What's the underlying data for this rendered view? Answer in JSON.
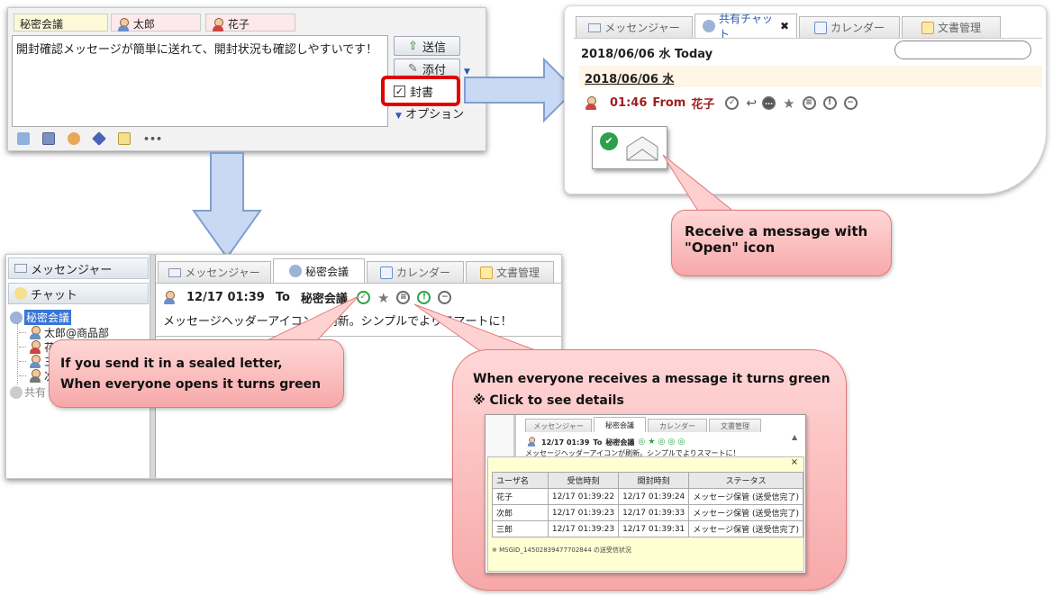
{
  "composer": {
    "recipients": [
      "秘密会議",
      "太郎",
      "花子"
    ],
    "message": "開封確認メッセージが簡単に送れて、開封状況も確認しやすいです！",
    "send_label": "送信",
    "attach_label": "添付",
    "seal_label": "封書",
    "sealed_checked": true,
    "options_label": "オプション",
    "more_label": "•••"
  },
  "receiver": {
    "tabs": [
      "メッセンジャー",
      "共有チャット",
      "カレンダー",
      "文書管理"
    ],
    "active_tab": "共有チャット",
    "close_glyph": "✖",
    "date_header": "2018/06/06 水 Today",
    "date_line": "2018/06/06 水",
    "msg_time": "01:46",
    "msg_from": "From",
    "msg_sender": "花子",
    "open_check": "✔"
  },
  "sender": {
    "sidebar": {
      "items": [
        "メッセンジャー",
        "チャット"
      ],
      "tree_root": "秘密会議",
      "tree_children": [
        "太郎@商品部",
        "花",
        "三",
        "次"
      ],
      "shared": "共有"
    },
    "tabs": [
      "メッセンジャー",
      "秘密会議",
      "カレンダー",
      "文書管理"
    ],
    "active_tab": "秘密会議",
    "msg_time": "12/17 01:39",
    "msg_to": "To",
    "msg_target": "秘密会議",
    "msg_body": "メッセージヘッダーアイコンが刷新。シンプルでよりスマートに！"
  },
  "details": {
    "tabs": [
      "メッセンジャー",
      "秘密会議",
      "カレンダー",
      "文書管理"
    ],
    "msg_time": "12/17 01:39",
    "msg_to": "To",
    "msg_target": "秘密会議",
    "msg_body": "メッセージヘッダーアイコンが刷新。シンプルでよりスマートに！",
    "close": "×",
    "columns": [
      "ユーザ名",
      "受信時刻",
      "開封時刻",
      "ステータス"
    ],
    "rows": [
      [
        "花子",
        "12/17 01:39:22",
        "12/17 01:39:24",
        "メッセージ保管 (送受信完了)"
      ],
      [
        "次郎",
        "12/17 01:39:23",
        "12/17 01:39:33",
        "メッセージ保管 (送受信完了)"
      ],
      [
        "三郎",
        "12/17 01:39:23",
        "12/17 01:39:31",
        "メッセージ保管 (送受信完了)"
      ]
    ],
    "footer": "※ MSGID_14502839477702844 の送受信状況"
  },
  "callouts": {
    "receive_line1": "Receive a message with",
    "receive_line2": "\"Open\" icon",
    "sealed_line1": "If you send it in a sealed letter,",
    "sealed_line2": "When everyone opens it turns green",
    "green_line1": "When everyone receives a message it turns green",
    "green_line2": "※ Click to see details"
  },
  "colors": {
    "arrow_fill": "#c9d9f3",
    "arrow_border": "#7f9fd0",
    "callout_fill": "#f7a8a8",
    "highlight_red": "#e00000",
    "green_status": "#2aa14a",
    "date_band": "#fff6e6"
  }
}
